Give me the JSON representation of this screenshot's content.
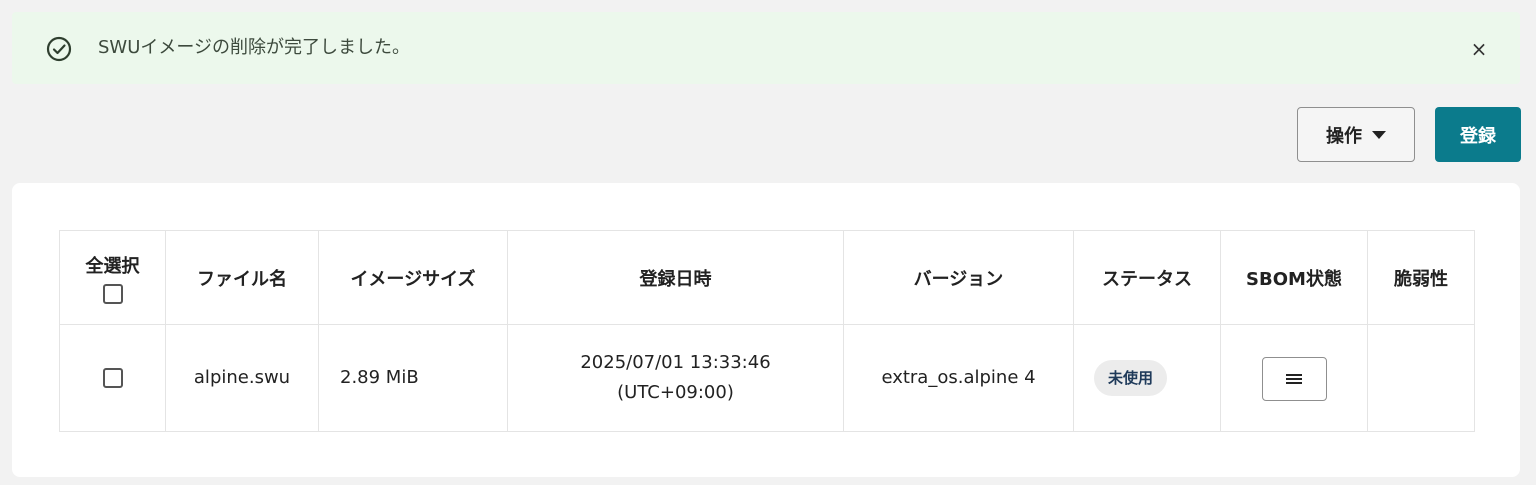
{
  "alert": {
    "message": "SWUイメージの削除が完了しました。",
    "close_label": "×",
    "icon": "check-circle-icon",
    "color": "#ecf8ec"
  },
  "toolbar": {
    "operations_label": "操作",
    "register_label": "登録",
    "register_color": "#0b7b8c"
  },
  "table": {
    "headers": {
      "select_all": "全選択",
      "file_name": "ファイル名",
      "image_size": "イメージサイズ",
      "registered_at": "登録日時",
      "version": "バージョン",
      "status": "ステータス",
      "sbom": "SBOM状態",
      "vulnerability": "脆弱性"
    },
    "rows": [
      {
        "file_name": "alpine.swu",
        "image_size": "2.89 MiB",
        "registered_date": "2025/07/01 13:33:46",
        "registered_tz": "(UTC+09:00)",
        "version": "extra_os.alpine 4",
        "status": "未使用",
        "sbom_icon": "menu-icon",
        "vulnerability": ""
      }
    ]
  }
}
